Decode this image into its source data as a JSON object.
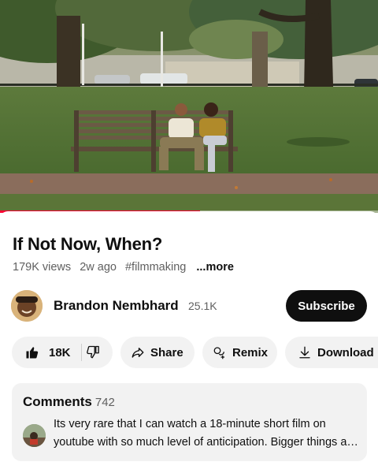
{
  "video": {
    "scene": "park-bench-thumbnail",
    "progress_fraction": 0.53
  },
  "title": "If Not Now, When?",
  "meta": {
    "views": "179K views",
    "age": "2w ago",
    "hashtag": "#filmmaking",
    "more_label": "...more"
  },
  "channel": {
    "name": "Brandon Nembhard",
    "subscribers": "25.1K",
    "subscribe_label": "Subscribe"
  },
  "actions": {
    "like_count": "18K",
    "like_icon": "thumbs-up-icon",
    "dislike_icon": "thumbs-down-icon",
    "share_label": "Share",
    "share_icon": "share-arrow-icon",
    "remix_label": "Remix",
    "remix_icon": "remix-icon",
    "download_label": "Download",
    "download_icon": "download-icon"
  },
  "comments": {
    "heading": "Comments",
    "count": "742",
    "top_comment": "Its very rare that I can watch a 18-minute short film on youtube with so much level of anticipation. Bigger things are coming for you"
  },
  "colors": {
    "accent_red": "#ff0033",
    "subscribe_bg": "#0f0f0f",
    "pill_bg": "#f2f2f2",
    "secondary_text": "#606060"
  }
}
